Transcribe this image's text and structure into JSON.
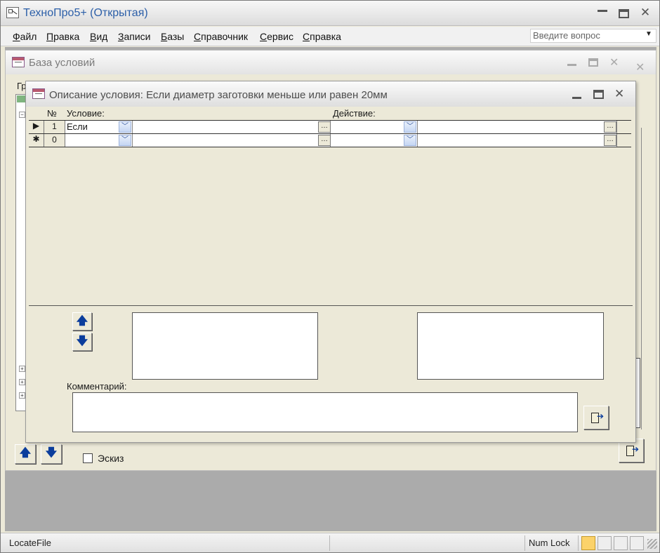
{
  "app": {
    "title": "ТехноПро5+ (Открытая)",
    "minimize": "▁",
    "maximize": "❐",
    "close": "✕"
  },
  "menu": {
    "items": [
      "Файл",
      "Правка",
      "Вид",
      "Записи",
      "Базы",
      "Справочник",
      "Сервис",
      "Справка"
    ],
    "question_placeholder": "Введите вопрос"
  },
  "win1": {
    "title": "База условий",
    "label_partial": "Гр",
    "sketch_label": "Эскиз",
    "up": "🡅",
    "down": "🡇"
  },
  "win2": {
    "title": "Описание условия: Если диаметр заготовки меньше или равен 20мм",
    "headers": {
      "num": "№",
      "condition": "Условие:",
      "action": "Действие:"
    },
    "rows": [
      {
        "selector": "▶",
        "num": "1",
        "condition": "Если",
        "condition_text": "",
        "action": "",
        "action_text": ""
      },
      {
        "selector": "✱",
        "num": "0",
        "condition": "",
        "condition_text": "",
        "action": "",
        "action_text": ""
      }
    ],
    "comment_label": "Комментарий:",
    "comment_value": "",
    "up": "🡅",
    "down": "🡇"
  },
  "status": {
    "left": "LocateFile",
    "numlock": "Num Lock"
  }
}
